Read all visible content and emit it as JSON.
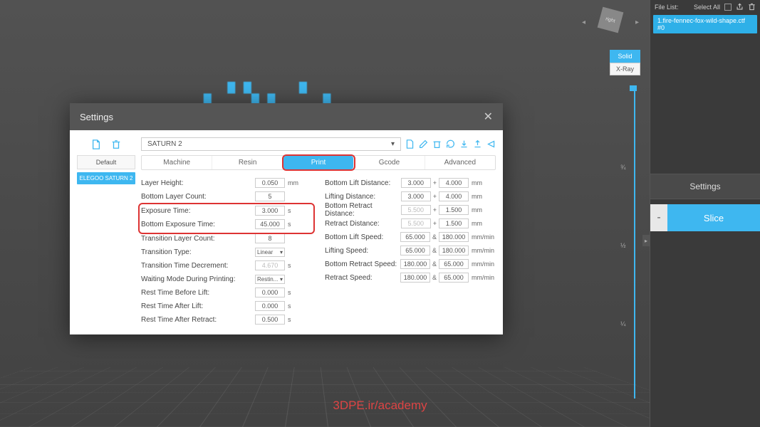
{
  "viewport": {
    "cube_label": "right"
  },
  "right_panel": {
    "file_list_label": "File List:",
    "select_all_label": "Select All",
    "file_item": "1.fire-fennec-fox-wild-shape.ctf #0",
    "view_solid": "Solid",
    "view_xray": "X-Ray",
    "ruler_marks": {
      "top": "¾",
      "mid": "½",
      "bot": "¼"
    },
    "settings_label": "Settings",
    "minus": "-",
    "slice_label": "Slice"
  },
  "modal": {
    "title": "Settings",
    "sidebar": {
      "default_label": "Default",
      "preset_label": "ELEGOO SATURN 2"
    },
    "profile": {
      "selected": "SATURN 2"
    },
    "tabs": {
      "machine": "Machine",
      "resin": "Resin",
      "print": "Print",
      "gcode": "Gcode",
      "advanced": "Advanced"
    },
    "left_col": {
      "layer_height": {
        "label": "Layer Height:",
        "value": "0.050",
        "unit": "mm"
      },
      "bottom_layer_count": {
        "label": "Bottom Layer Count:",
        "value": "5"
      },
      "exposure_time": {
        "label": "Exposure Time:",
        "value": "3.000",
        "unit": "s"
      },
      "bottom_exposure_time": {
        "label": "Bottom Exposure Time:",
        "value": "45.000",
        "unit": "s"
      },
      "transition_layer_count": {
        "label": "Transition Layer Count:",
        "value": "8"
      },
      "transition_type": {
        "label": "Transition Type:",
        "value": "Linear"
      },
      "transition_time_decrement": {
        "label": "Transition Time Decrement:",
        "value": "4.670",
        "unit": "s"
      },
      "waiting_mode": {
        "label": "Waiting Mode During Printing:",
        "value": "Restin..."
      },
      "rest_before_lift": {
        "label": "Rest Time Before Lift:",
        "value": "0.000",
        "unit": "s"
      },
      "rest_after_lift": {
        "label": "Rest Time After Lift:",
        "value": "0.000",
        "unit": "s"
      },
      "rest_after_retract": {
        "label": "Rest Time After Retract:",
        "value": "0.500",
        "unit": "s"
      }
    },
    "right_col": {
      "bottom_lift_distance": {
        "label": "Bottom Lift Distance:",
        "v1": "3.000",
        "sep": "+",
        "v2": "4.000",
        "unit": "mm"
      },
      "lifting_distance": {
        "label": "Lifting Distance:",
        "v1": "3.000",
        "sep": "+",
        "v2": "4.000",
        "unit": "mm"
      },
      "bottom_retract_distance": {
        "label": "Bottom Retract Distance:",
        "v1": "5.500",
        "sep": "+",
        "v2": "1.500",
        "unit": "mm"
      },
      "retract_distance": {
        "label": "Retract Distance:",
        "v1": "5.500",
        "sep": "+",
        "v2": "1.500",
        "unit": "mm"
      },
      "bottom_lift_speed": {
        "label": "Bottom Lift Speed:",
        "v1": "65.000",
        "sep": "&",
        "v2": "180.000",
        "unit": "mm/min"
      },
      "lifting_speed": {
        "label": "Lifting Speed:",
        "v1": "65.000",
        "sep": "&",
        "v2": "180.000",
        "unit": "mm/min"
      },
      "bottom_retract_speed": {
        "label": "Bottom Retract Speed:",
        "v1": "180.000",
        "sep": "&",
        "v2": "65.000",
        "unit": "mm/min"
      },
      "retract_speed": {
        "label": "Retract Speed:",
        "v1": "180.000",
        "sep": "&",
        "v2": "65.000",
        "unit": "mm/min"
      }
    }
  },
  "watermark": "3DPE.ir/academy"
}
